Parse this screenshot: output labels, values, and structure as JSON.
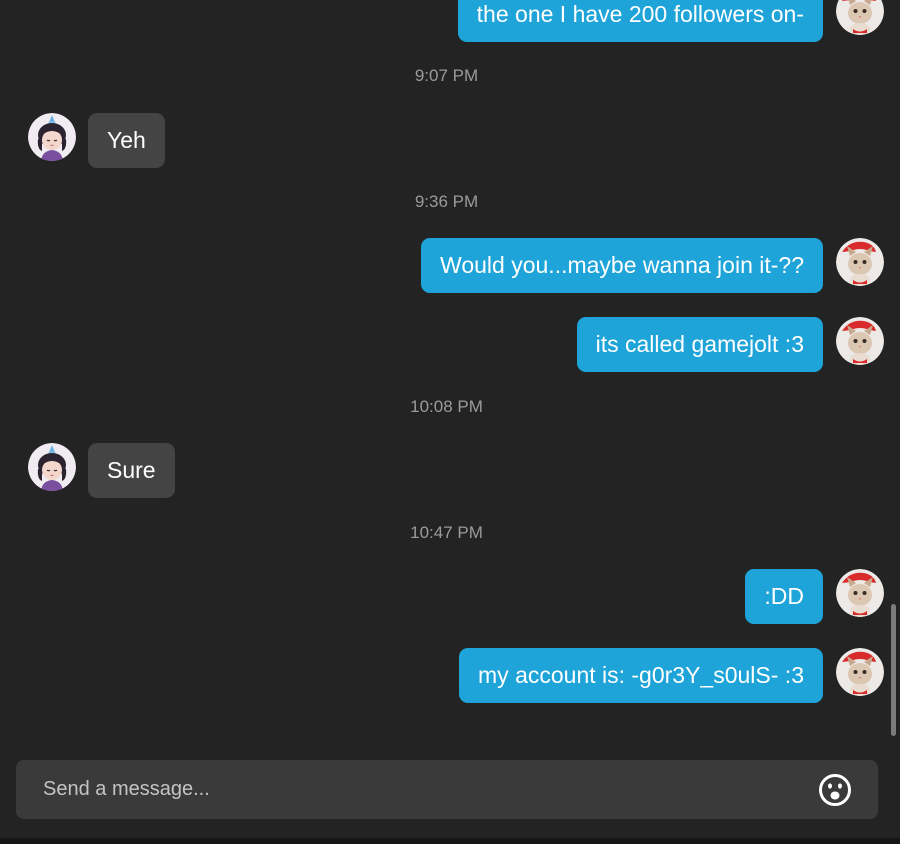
{
  "colors": {
    "background": "#232323",
    "outgoing_bubble": "#1ea4d8",
    "incoming_bubble": "#444444",
    "timestamp_text": "#9b9b9b",
    "composer_background": "#3a3a3a"
  },
  "messages": [
    {
      "type": "out",
      "text": "the one I have 200 followers on-"
    },
    {
      "type": "time",
      "text": "9:07 PM"
    },
    {
      "type": "in",
      "text": "Yeh"
    },
    {
      "type": "time",
      "text": "9:36 PM"
    },
    {
      "type": "out",
      "text": "Would you...maybe wanna join it-??"
    },
    {
      "type": "out",
      "text": "its called gamejolt :3"
    },
    {
      "type": "time",
      "text": "10:08 PM"
    },
    {
      "type": "in",
      "text": "Sure"
    },
    {
      "type": "time",
      "text": "10:47 PM"
    },
    {
      "type": "out",
      "text": ":DD"
    },
    {
      "type": "out",
      "text": "my account is: -g0r3Y_s0ulS- :3"
    }
  ],
  "avatars": {
    "self": "cat-avatar",
    "other": "girl-avatar"
  },
  "composer": {
    "placeholder": "Send a message...",
    "value": "",
    "emoji_icon": "smiley-icon"
  }
}
